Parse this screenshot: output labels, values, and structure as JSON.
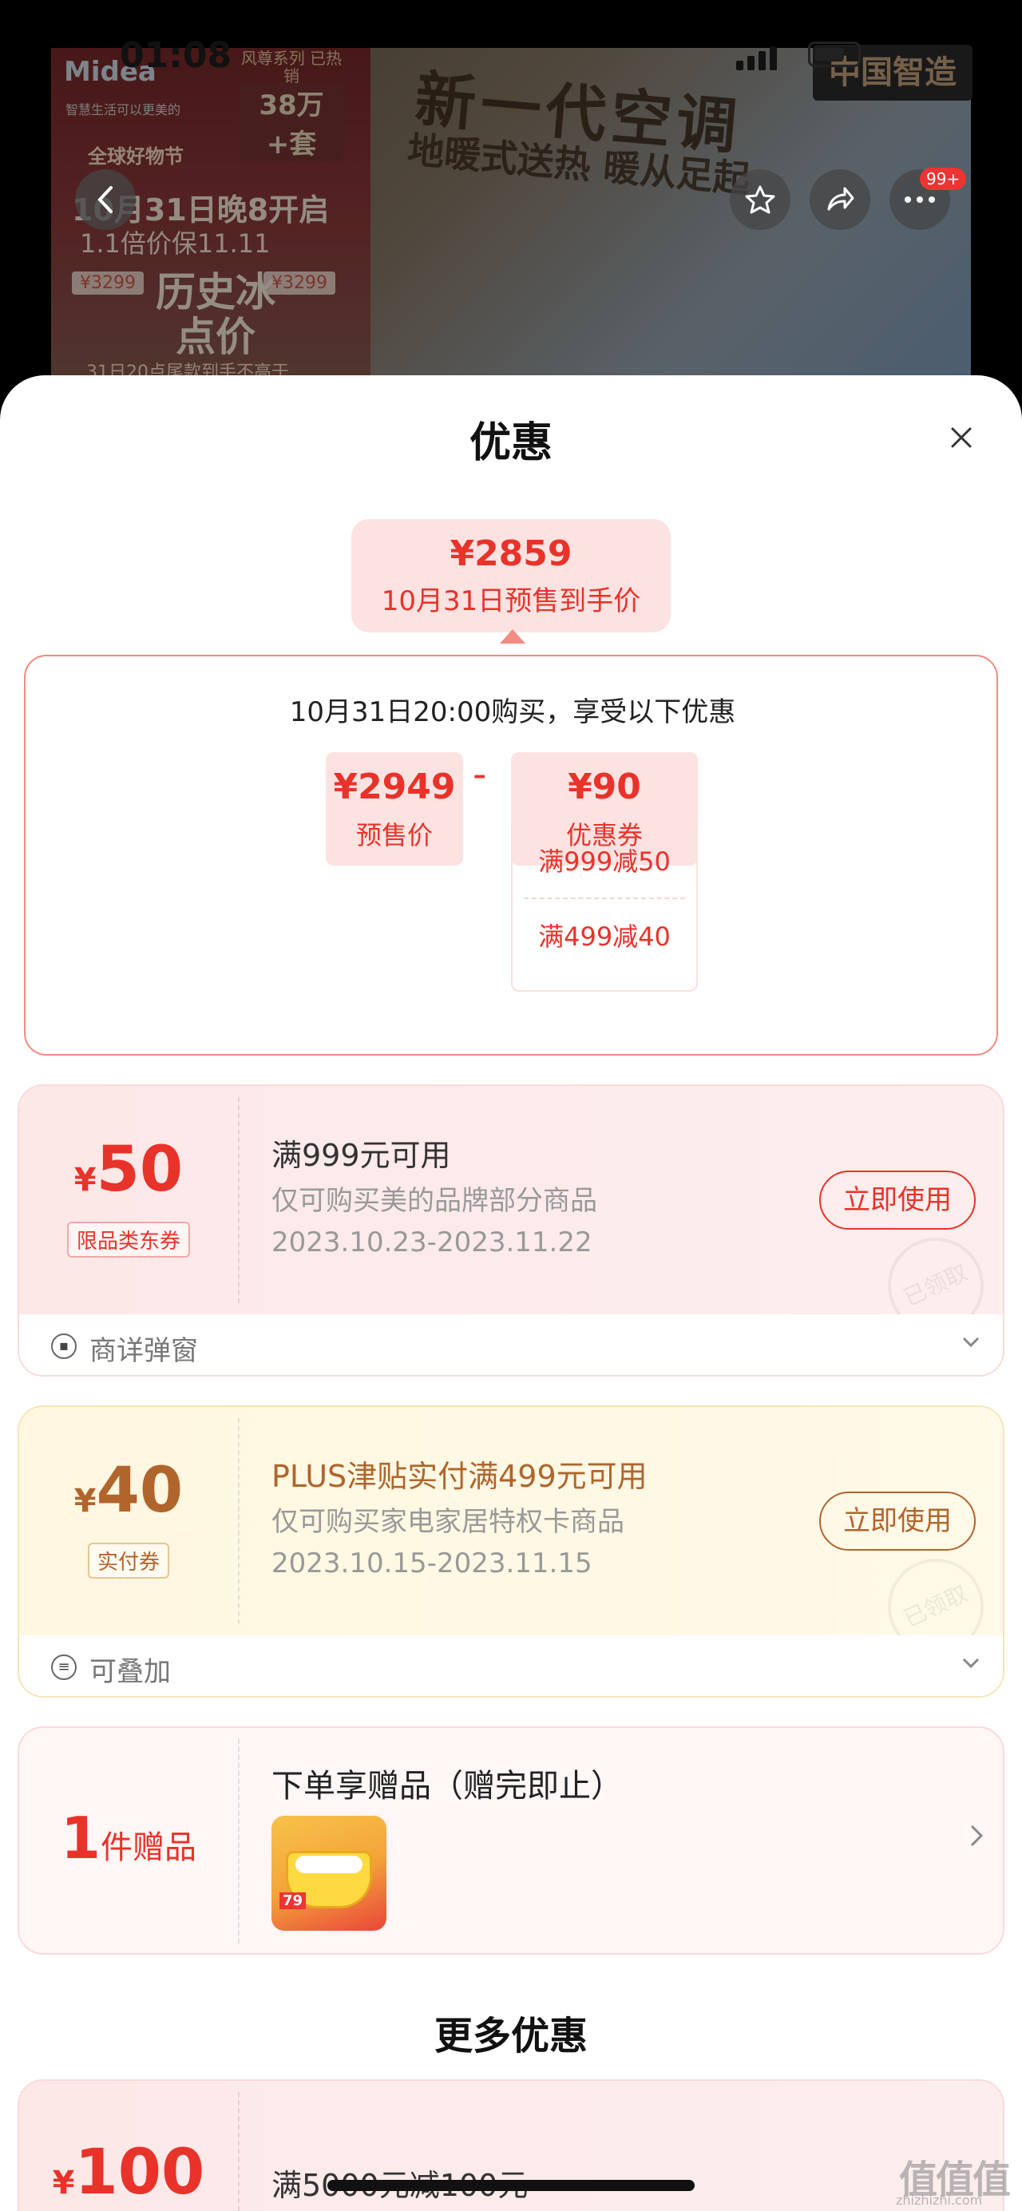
{
  "status_bar": {
    "time": "01:08"
  },
  "banner": {
    "brand": "Midea",
    "brand_slogan": "智慧生活可以更美的",
    "series_label": "风尊系列 已热销",
    "series_count": "38万+套",
    "headline": "新一代空调",
    "subheadline": "地暖式送热 暖从足起",
    "promo_event": "全球好物节",
    "promo_date": "10月31日晚8开启",
    "promo_guarantee": "1.1倍价保11.11",
    "old_price_left": "¥3299",
    "old_price_right": "¥3299",
    "lowest_label": "历史冰点价",
    "promo_footer": "31日20点尾款到手不高于",
    "store_badge": "中国智造",
    "cart_count": "99+"
  },
  "sheet": {
    "title": "优惠",
    "final_price": {
      "amount": "¥2859",
      "label": "10月31日预售到手价"
    },
    "calc": {
      "heading": "10月31日20:00购买，享受以下优惠",
      "presale": {
        "value": "¥2949",
        "label": "预售价"
      },
      "operator": "-",
      "coupon": {
        "value": "¥90",
        "label": "优惠券"
      },
      "coupon_items": [
        "满999减50",
        "满499减40"
      ]
    },
    "coupons": [
      {
        "yen": "¥",
        "amount": "50",
        "tag": "限品类东券",
        "title": "满999元可用",
        "desc": "仅可购买美的品牌部分商品",
        "date": "2023.10.23-2023.11.22",
        "button": "立即使用",
        "stamp": "已领取",
        "footer": "商详弹窗",
        "footer_icon": "coupon-icon"
      },
      {
        "yen": "¥",
        "amount": "40",
        "tag": "实付券",
        "title": "PLUS津贴实付满499元可用",
        "desc": "仅可购买家电家居特权卡商品",
        "date": "2023.10.15-2023.11.15",
        "button": "立即使用",
        "stamp": "已领取",
        "footer": "可叠加",
        "footer_icon": "stack-icon"
      }
    ],
    "gift": {
      "count": "1",
      "unit": "件赠品",
      "title": "下单享赠品（赠完即止）",
      "thumb_price": "79"
    },
    "more_title": "更多优惠",
    "more_coupon": {
      "yen": "¥",
      "amount": "100",
      "title": "满5000元减100元"
    }
  },
  "watermark": {
    "text": "值值值",
    "sub": "zhizhizhi.com"
  },
  "colors": {
    "accent_red": "#e8332a",
    "accent_gold": "#b0652d",
    "pink_bg": "#fde2e2",
    "yellow_bg": "#fff7e0"
  }
}
